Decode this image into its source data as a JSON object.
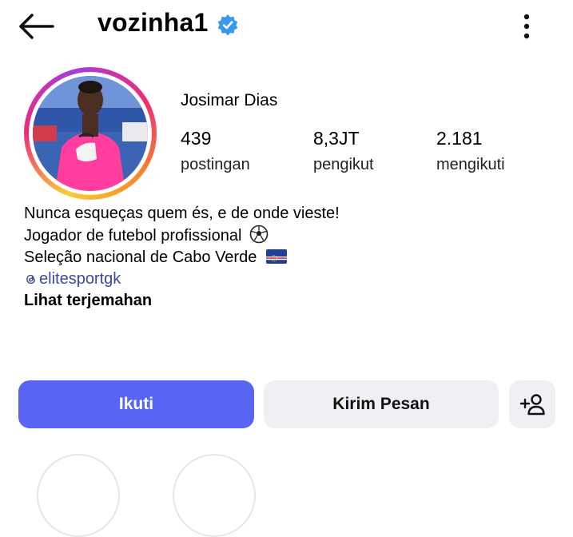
{
  "header": {
    "username": "vozinha1",
    "icons": [
      "back-arrow-icon",
      "verified-badge-icon",
      "more-vertical-icon"
    ]
  },
  "profile": {
    "full_name": "Josimar Dias",
    "stats": [
      {
        "value": "439",
        "label": "postingan"
      },
      {
        "value": "8,3JT",
        "label": "pengikut"
      },
      {
        "value": "2.181",
        "label": "mengikuti"
      }
    ]
  },
  "bio": {
    "line1": "Nunca esqueças quem és, e de onde vieste!",
    "line2": "Jogador de futebol profissional",
    "line3": "Seleção nacional de Cabo Verde",
    "link": "elitesportgk",
    "translate": "Lihat terjemahan",
    "icons": [
      "soccer-ball-icon",
      "cabo-verde-flag-icon",
      "threads-icon"
    ]
  },
  "actions": {
    "follow": "Ikuti",
    "message": "Kirim Pesan",
    "add_user_icon": "add-user-icon"
  },
  "colors": {
    "follow_button": "#5865f2",
    "secondary_button": "#eff0f3",
    "link": "#3a4a9c",
    "verified": "#3897f0"
  }
}
